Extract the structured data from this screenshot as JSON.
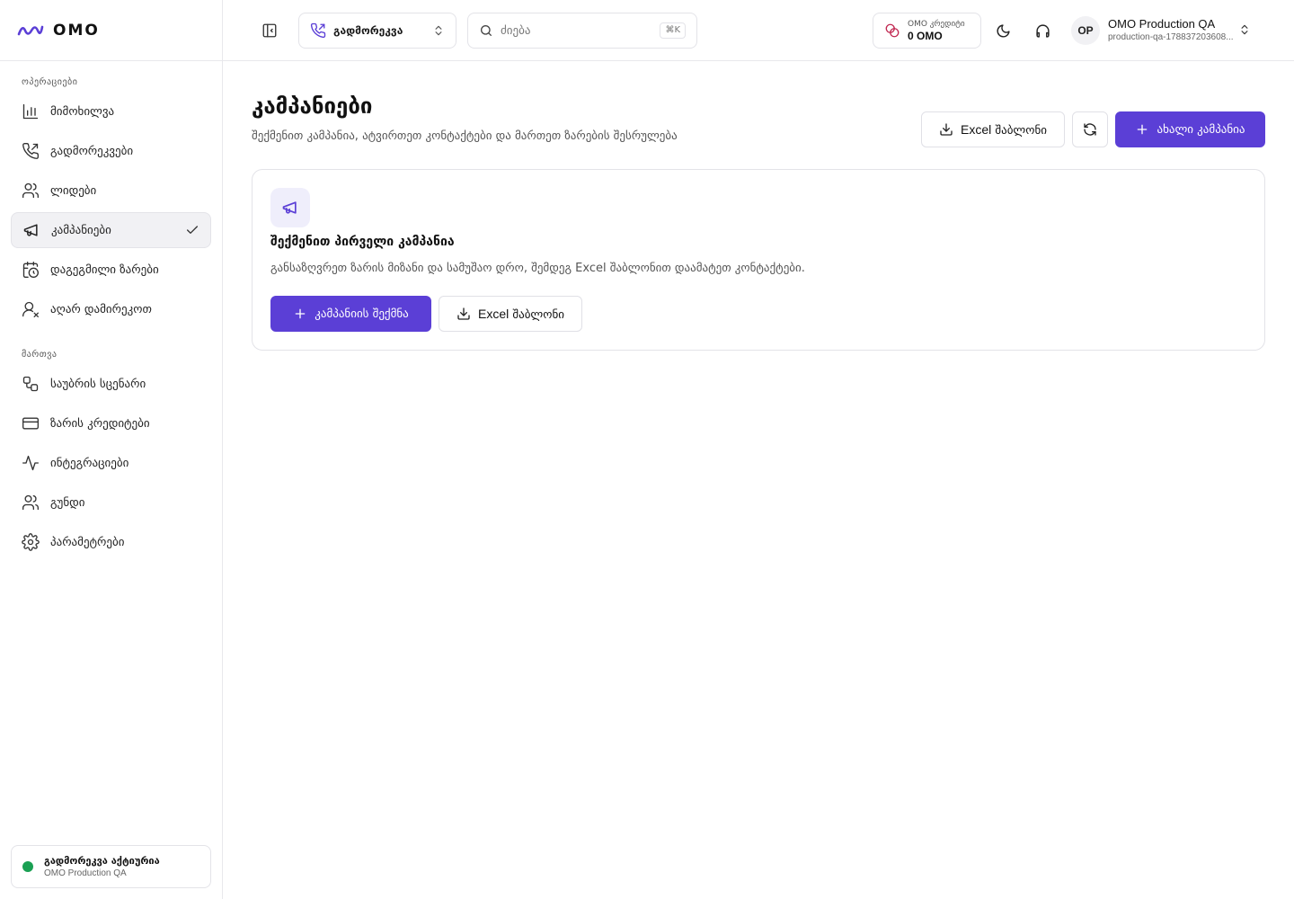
{
  "brand": {
    "name": "OMO"
  },
  "sidebar": {
    "operations_title": "ოპერაციები",
    "operations": [
      {
        "label": "მიმოხილვა",
        "icon": "bar-chart-icon"
      },
      {
        "label": "გადმორეკვები",
        "icon": "phone-outgoing-icon"
      },
      {
        "label": "ლიდები",
        "icon": "users-icon"
      },
      {
        "label": "კამპანიები",
        "icon": "megaphone-icon",
        "active": true
      },
      {
        "label": "დაგეგმილი ზარები",
        "icon": "calendar-clock-icon"
      },
      {
        "label": "აღარ დამირეკოთ",
        "icon": "user-x-icon"
      }
    ],
    "management_title": "მართვა",
    "management": [
      {
        "label": "საუბრის სცენარი",
        "icon": "workflow-icon"
      },
      {
        "label": "ზარის კრედიტები",
        "icon": "credit-card-icon"
      },
      {
        "label": "ინტეგრაციები",
        "icon": "activity-icon"
      },
      {
        "label": "გუნდი",
        "icon": "team-icon"
      },
      {
        "label": "პარამეტრები",
        "icon": "gear-icon"
      }
    ],
    "status": {
      "title": "გადმორეკვა აქტიურია",
      "org": "OMO Production QA",
      "color": "#1aa053"
    }
  },
  "topbar": {
    "mode_label": "გადმორეკვა",
    "search_placeholder": "ძიება",
    "search_shortcut": "⌘K",
    "credits_label": "OMO კრედიტი",
    "credits_value": "0 OMO",
    "avatar_initials": "OP",
    "org_name": "OMO Production QA",
    "org_id": "production-qa-178837203608..."
  },
  "main": {
    "title": "კამპანიები",
    "subtitle": "შექმენით კამპანია, ატვირთეთ კონტაქტები და მართეთ ზარების შესრულება",
    "excel_button_word": "Excel",
    "excel_button_rest": "შაბლონი",
    "new_campaign_label": "ახალი კამპანია",
    "empty": {
      "title": "შექმენით პირველი კამპანია",
      "description": "განსაზღვრეთ ზარის მიზანი და სამუშაო დრო, შემდეგ Excel შაბლონით დაამატეთ კონტაქტები.",
      "create_label": "კამპანიის შექმნა",
      "excel_word": "Excel",
      "excel_rest": "შაბლონი"
    }
  },
  "colors": {
    "accent": "#5b3fd6",
    "status_green": "#1aa053",
    "border": "#e3e3e8"
  }
}
